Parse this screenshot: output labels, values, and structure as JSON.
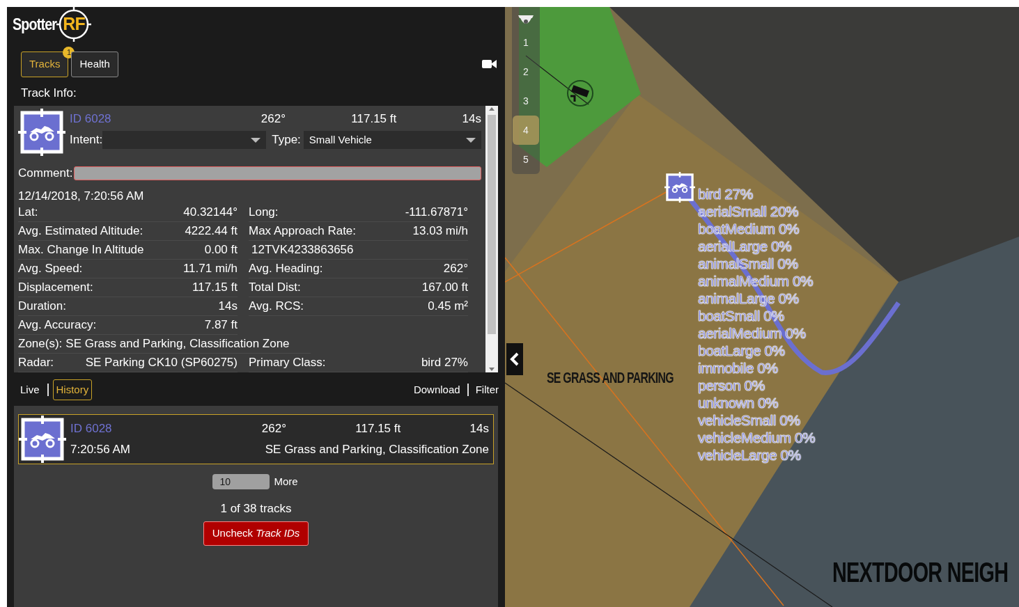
{
  "logo": {
    "text": "Spotter",
    "accent": "RF"
  },
  "tabs": [
    {
      "label": "Tracks",
      "selected": true,
      "badge": "1"
    },
    {
      "label": "Health",
      "selected": false
    }
  ],
  "section_title": "Track Info:",
  "track_info": {
    "id": "ID 6028",
    "heading": "262°",
    "distance": "117.15 ft",
    "duration": "14s",
    "intent": {
      "label": "Intent:"
    },
    "type": {
      "label": "Type:",
      "value": "Small Vehicle"
    },
    "comment": {
      "label": "Comment:"
    },
    "timestamp": "12/14/2018, 7:20:56 AM",
    "rows": [
      {
        "kind": "pair",
        "cells": [
          {
            "label": "Lat:",
            "value": "40.32144°"
          },
          {
            "label": "Long:",
            "value": "-111.67871°"
          }
        ]
      },
      {
        "kind": "pair",
        "cells": [
          {
            "label": "Avg. Estimated Altitude:",
            "value": "4222.44 ft"
          },
          {
            "label": "Max Approach Rate:",
            "value": "13.03 mi/h"
          }
        ]
      },
      {
        "kind": "pair",
        "cells": [
          {
            "label": "Max. Change In Altitude",
            "value": "0.00 ft"
          },
          {
            "value": "12TVK4233863656"
          }
        ]
      },
      {
        "kind": "pair",
        "cells": [
          {
            "label": "Avg. Speed:",
            "value": "11.71 mi/h"
          },
          {
            "label": "Avg. Heading:",
            "value": "262°"
          }
        ]
      },
      {
        "kind": "pair",
        "cells": [
          {
            "label": "Displacement:",
            "value": "117.15 ft"
          },
          {
            "label": "Total Dist:",
            "value": "167.00 ft"
          }
        ]
      },
      {
        "kind": "pair",
        "cells": [
          {
            "label": "Duration:",
            "value": "14s"
          },
          {
            "label": "Avg. RCS:",
            "value": "0.45 m²"
          }
        ]
      },
      {
        "kind": "pair",
        "cells": [
          {
            "label": "Avg. Accuracy:",
            "value": "7.87 ft"
          }
        ]
      },
      {
        "kind": "full",
        "cells": [
          {
            "label": "Zone(s):",
            "value": "SE Grass and Parking, Classification Zone"
          }
        ]
      },
      {
        "kind": "pair",
        "cells": [
          {
            "label": "Radar:",
            "value": "SE Parking CK10 (SP60275)"
          },
          {
            "label": "Primary Class:",
            "value": "bird 27%"
          }
        ]
      }
    ]
  },
  "view_toggle": [
    {
      "label": "Live",
      "selected": false
    },
    {
      "label": "History",
      "selected": true
    }
  ],
  "actions": [
    "Download",
    "Filter"
  ],
  "history_tracks": [
    {
      "id": "ID 6028",
      "heading": "262°",
      "distance": "117.15 ft",
      "duration": "14s",
      "time": "7:20:56 AM",
      "zones": "SE Grass and Parking, Classification Zone",
      "selected": true
    }
  ],
  "page_size": {
    "value": "10",
    "button": "More"
  },
  "track_count": "1 of 38 tracks",
  "uncheck_button": "Uncheck *Track IDs*",
  "map": {
    "layers": [
      {
        "label": "1",
        "selected": false
      },
      {
        "label": "2",
        "selected": false
      },
      {
        "label": "3",
        "selected": false
      },
      {
        "label": "4",
        "selected": true
      },
      {
        "label": "5",
        "selected": false
      }
    ],
    "zone_labels": [
      "SE GRASS AND PARKING",
      "NEXTDOOR NEIGH"
    ],
    "classes": [
      "bird 27%",
      "aerialSmall 20%",
      "boatMedium 0%",
      "aerialLarge 0%",
      "animalSmall 0%",
      "animalMedium 0%",
      "animalLarge 0%",
      "boatSmall 0%",
      "aerialMedium 0%",
      "boatLarge 0%",
      "immobile 0%",
      "person 0%",
      "unknown 0%",
      "vehicleSmall 0%",
      "vehicleMedium 0%",
      "vehicleLarge 0%"
    ]
  }
}
